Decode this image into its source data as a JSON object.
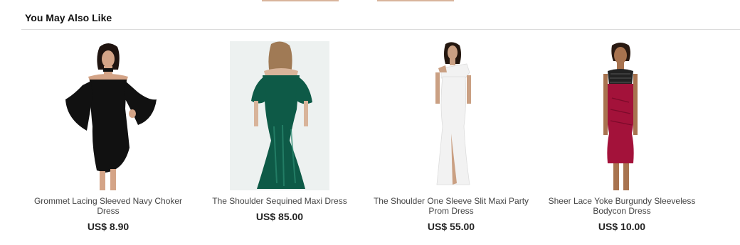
{
  "section": {
    "title": "You May Also Like"
  },
  "products": [
    {
      "name": "Grommet Lacing Sleeved Navy Choker Dress",
      "price": "US$ 8.90",
      "image_icon": "black-bell-sleeve-dress-image",
      "dress_color": "#111111"
    },
    {
      "name": "The Shoulder Sequined Maxi Dress",
      "price": "US$ 85.00",
      "image_icon": "green-sequin-maxi-dress-image",
      "dress_color": "#0e5a47"
    },
    {
      "name": "The Shoulder One Sleeve Slit Maxi Party Prom Dress",
      "price": "US$ 55.00",
      "image_icon": "white-one-shoulder-gown-image",
      "dress_color": "#f2f2f2"
    },
    {
      "name": "Sheer Lace Yoke Burgundy Sleeveless Bodycon Dress",
      "price": "US$ 10.00",
      "image_icon": "burgundy-lace-bodycon-dress-image",
      "dress_color": "#a3123a"
    }
  ]
}
